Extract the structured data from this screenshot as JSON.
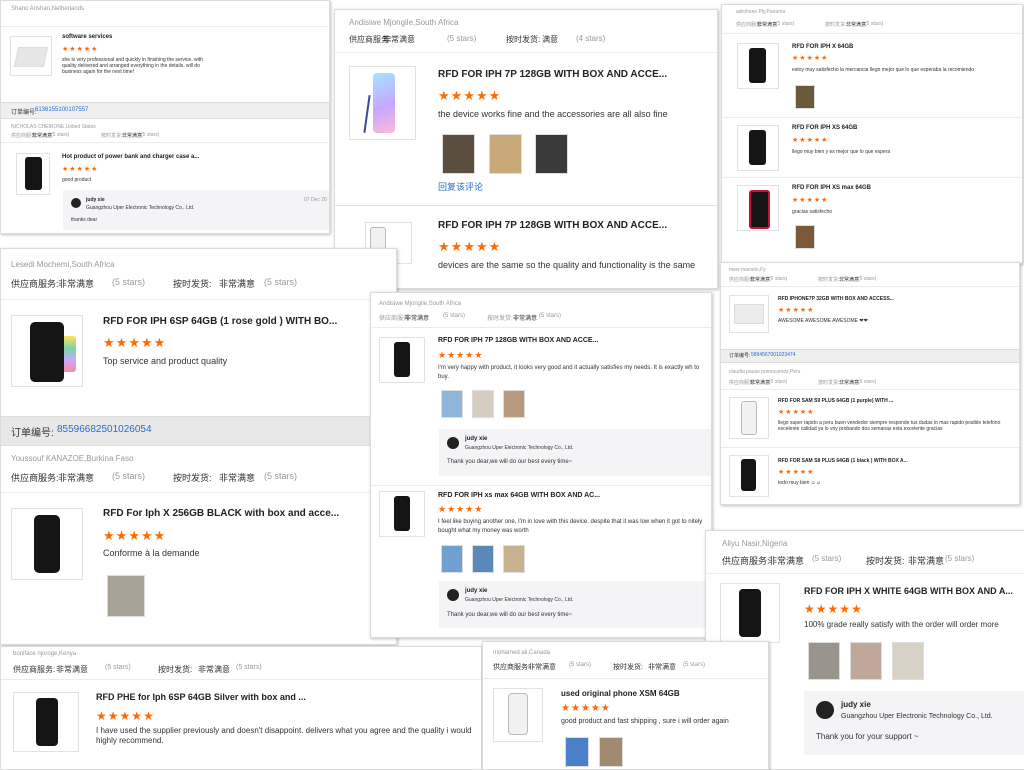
{
  "labels": {
    "supplier": "供应商服务:",
    "shipping": "按时发货:",
    "very_satisfied": "非常满意",
    "satisfied": "满意",
    "stars5": "(5 stars)",
    "stars4": "(4 stars)",
    "order_no": "订单编号:",
    "reply_comment": "回复该评论",
    "reply_name": "judy xie",
    "reply_company": "Guangzhou Uper Electronic Technology Co., Ltd.",
    "reply_company_short": "Guangzhou Uper Electronic Technology Co,. Ltd.",
    "reply_date": "07 Dec 20"
  },
  "accent_colors": {
    "stars": "#ff6a00",
    "order_number": "#2a6cc7"
  },
  "c1": {
    "buyer": "Shano Anshan,Netherlands",
    "product": "software services",
    "comment": "she is very professional and quickly in finishing the service. with quality delivered and arranged everything in the details. will do business again for the next time!",
    "order_number": "6136155100107557",
    "buyer2": "NICHOLAS CHEIRONE,United States",
    "product2": "Hot product of power bank and charger case a...",
    "comment2": "good product",
    "reply": "thanks dear"
  },
  "c2": {
    "buyer": "Andisiwe Mjongile,South Africa",
    "product": "RFD FOR IPH 7P 128GB WITH BOX AND ACCE...",
    "comment": "the device works fine and the accessories are all also fine",
    "product2": "RFD FOR IPH 7P 128GB WITH BOX AND ACCE...",
    "comment2": "devices are the same so the quality and functionality is the same"
  },
  "c3": {
    "buyer": "adrohone Ply,Panama",
    "p1": "RFD FOR IPH X 64GB",
    "c1": "estoy muy satisfecho la mercancia llego mejor que lo que esperaba la recomiendo",
    "p2": "RFD FOR IPH XS 64GB",
    "c2": "llego muy bien y es mejor que lo que espera",
    "p3": "RFD FOR IPH XS max 64GB",
    "c3": "gracias satisfecho"
  },
  "c4": {
    "buyer": "Lesedi Mochemi,South Africa",
    "product": "RFD FOR IPH 6SP 64GB (1 rose gold ) WITH BO...",
    "comment": "Top service and product quality",
    "order_number": "85596682501026054",
    "buyer2": "Youssouf KANAZOE,Burkina Faso",
    "product2": "RFD For Iph X 256GB BLACK with box and acce...",
    "comment2": "Conforme à la demande"
  },
  "c5": {
    "buyer": "Andisiwe Mjongile,South Africa",
    "product": "RFD FOR IPH 7P 128GB WITH BOX AND ACCE...",
    "comment": "I'm very happy with product, it looks very good and it actually satisfies my needs. It is exactly wh to buy.",
    "reply": "Thank you dear,we will do our best every time~",
    "product2": "RFD FOR IPH xs max 64GB WITH BOX AND AC...",
    "comment2": "I feel like buying another one, I'm in love with this device. despite that it was low when it got to nitely bought what my money was worth",
    "reply2": "Thank you dear,we will do our best every time~"
  },
  "c6": {
    "buyer": "mew marvelo,Fy",
    "product": "RFD IPHONE7P 32GB WITH BOX AND ACCESS...",
    "comment": "AWESOME AWESOME AWESOME ❤❤",
    "order_number": "5894567001023474",
    "buyer2": "claudia pause pomocamez,Peru",
    "product2": "RFD FOR SAM S9 PLUS 64GB (1 purple) WITH ...",
    "comment2": "llego super rapido a peru buen vendedor siempre responde tus dudas lo mas rapido posible telefono excelente calidad ya lo voy probando dos semanas esta excelente gracias",
    "product3": "RFD FOR SAM S8 PLUS 64GB (1 black ) WITH BOX A...",
    "comment3": "todo muy bien ☺☺"
  },
  "c7": {
    "buyer": "Aliyu Nasir,Nigeria",
    "product": "RFD FOR IPH X WHITE 64GB WITH BOX AND A...",
    "comment": "100% grade really satisfy with the order will order more",
    "reply": "Thank you for your support ~"
  },
  "c8": {
    "buyer": "boniface njoroge,Kenya",
    "product": "RFD PHE for Iph 6SP 64GB Silver with box and ...",
    "comment": "I have used the supplier previously and doesn't disappoint. delivers what you agree and the quality i would highly recommend."
  },
  "c9": {
    "buyer": "mohamed ali,Canada",
    "product": "used original phone XSM 64GB",
    "comment": "good product and fast shipping , sure i will order again"
  }
}
